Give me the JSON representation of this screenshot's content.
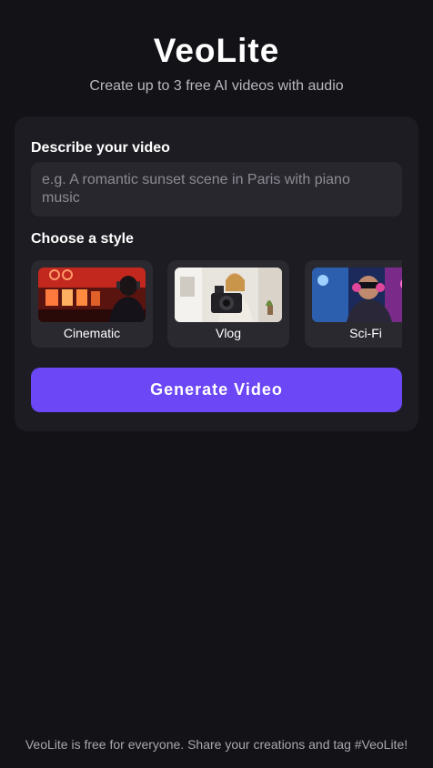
{
  "header": {
    "title": "VeoLite",
    "subtitle": "Create up to 3 free AI videos with audio"
  },
  "form": {
    "describe_label": "Describe your video",
    "prompt_placeholder": "e.g. A romantic sunset scene in Paris with piano music",
    "prompt_value": "",
    "style_label": "Choose a style",
    "styles": [
      {
        "label": "Cinematic",
        "thumbnail": "dark figure with headphones in neon-lit city street"
      },
      {
        "label": "Vlog",
        "thumbnail": "woman holding a camera in bright room"
      },
      {
        "label": "Sci-Fi",
        "thumbnail": "person in headset with pink and blue neon lights"
      }
    ],
    "generate_label": "Generate Video"
  },
  "footer": {
    "text": "VeoLite is free for everyone. Share your creations and tag #VeoLite!"
  },
  "colors": {
    "background": "#131217",
    "card": "#1d1c22",
    "input": "#28272e",
    "accent": "#6b47f5"
  }
}
